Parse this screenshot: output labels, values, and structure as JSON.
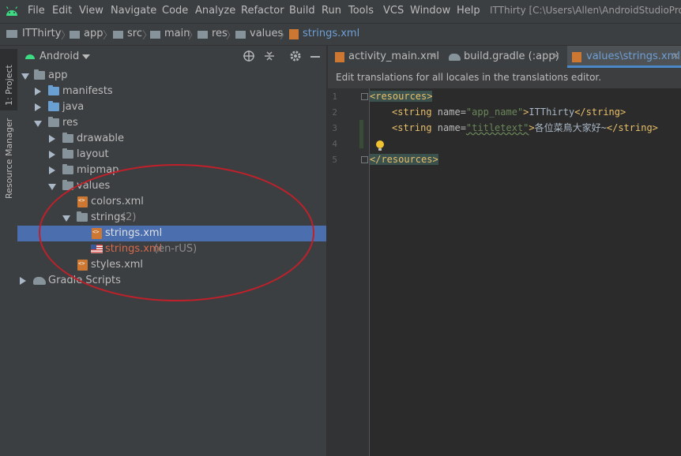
{
  "menubar": {
    "items": [
      "File",
      "Edit",
      "View",
      "Navigate",
      "Code",
      "Analyze",
      "Refactor",
      "Build",
      "Run",
      "Tools",
      "VCS",
      "Window",
      "Help"
    ],
    "window_title": "ITThirty [C:\\Users\\Allen\\AndroidStudioProje"
  },
  "breadcrumb": [
    "ITThirty",
    "app",
    "src",
    "main",
    "res",
    "values",
    "strings.xml"
  ],
  "left_strip": {
    "project_tab": "1: Project",
    "resource_manager_tab": "Resource Manager"
  },
  "project_panel": {
    "view_selector": "Android",
    "tree": [
      {
        "label": "app",
        "expanded": true
      },
      {
        "label": "manifests",
        "expanded": false
      },
      {
        "label": "java",
        "expanded": false
      },
      {
        "label": "res",
        "expanded": true
      },
      {
        "label": "drawable",
        "expanded": false
      },
      {
        "label": "layout",
        "expanded": false
      },
      {
        "label": "mipmap",
        "expanded": false
      },
      {
        "label": "values",
        "expanded": true
      },
      {
        "label": "colors.xml"
      },
      {
        "label": "strings",
        "count": "(2)",
        "expanded": true
      },
      {
        "label": "strings.xml",
        "selected": true
      },
      {
        "label": "strings.xml",
        "qualifier": "(en-rUS)"
      },
      {
        "label": "styles.xml"
      },
      {
        "label": "Gradle Scripts",
        "expanded": false
      }
    ]
  },
  "editor": {
    "tabs": [
      {
        "label": "activity_main.xml",
        "active": false
      },
      {
        "label": "build.gradle (:app)",
        "active": false
      },
      {
        "label": "values\\strings.xml",
        "active": true
      }
    ],
    "notice": "Edit translations for all locales in the translations editor.",
    "line_numbers": [
      "1",
      "2",
      "3",
      "4",
      "5"
    ],
    "code": {
      "l1_open": "<resources>",
      "l2_tag_open": "<string ",
      "l2_attr": "name=",
      "l2_value": "\"app_name\"",
      "l2_gt": ">",
      "l2_text": "ITThirty",
      "l2_close": "</string>",
      "l3_tag_open": "<string ",
      "l3_attr": "name=",
      "l3_value": "\"titletext\"",
      "l3_gt": ">",
      "l3_text": "各位菜鳥大家好~",
      "l3_close": "</string>",
      "l5_close": "</resources>"
    }
  },
  "colors": {
    "accent": "#4b6eaf",
    "annotation": "#c0202a",
    "tag": "#e8bf6a",
    "string_value": "#6a8759"
  }
}
